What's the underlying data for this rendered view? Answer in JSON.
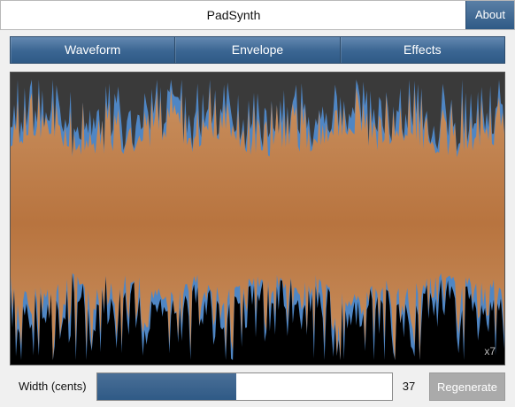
{
  "window": {
    "title": "PadSynth",
    "about_label": "About"
  },
  "tabs": [
    {
      "label": "Waveform",
      "active": true
    },
    {
      "label": "Envelope",
      "active": false
    },
    {
      "label": "Effects",
      "active": false
    }
  ],
  "waveform_display": {
    "zoom_label": "x7",
    "colors": {
      "background": "#000000",
      "upper_background": "#3a3a3a",
      "wave_fill": "#c08050",
      "wave_highlight": "#4f86c4"
    }
  },
  "controls": {
    "width_label": "Width (cents)",
    "width_value": "37",
    "width_fraction": 0.47,
    "regenerate_label": "Regenerate"
  },
  "colors": {
    "accent": "#2f5a86",
    "disabled": "#aaaaaa"
  }
}
